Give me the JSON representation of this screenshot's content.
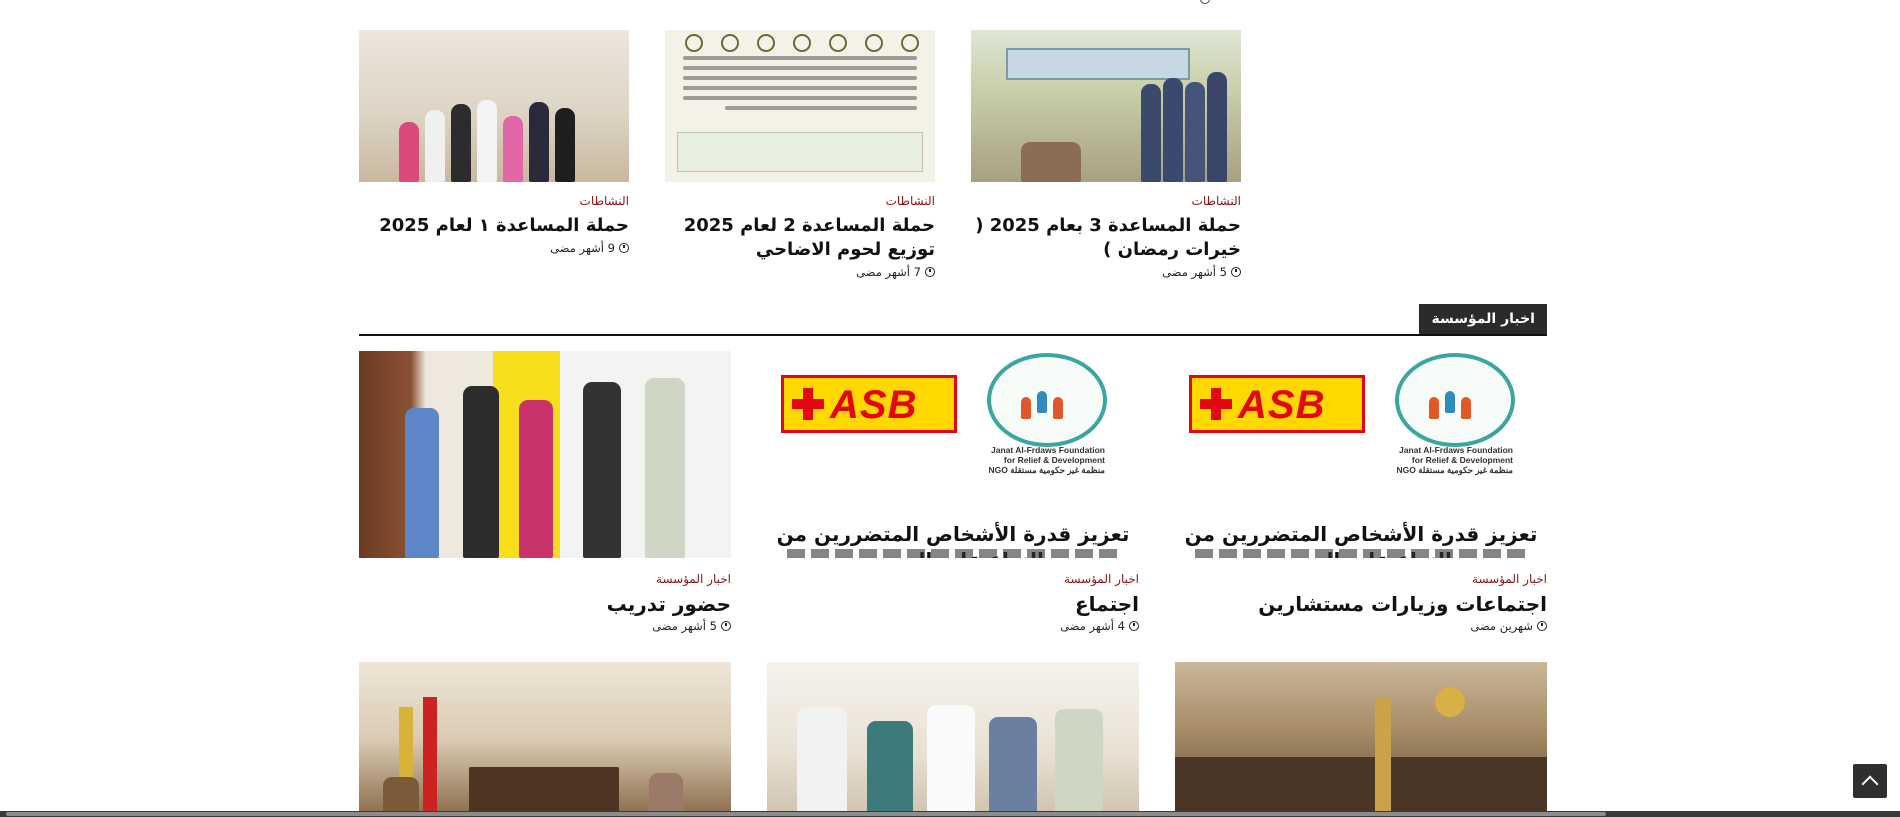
{
  "activities": [
    {
      "category": "النشاطات",
      "title": "حملة المساعدة ١ لعام 2025",
      "time": "9 أشهر مضى"
    },
    {
      "category": "النشاطات",
      "title": "حملة المساعدة 2 لعام 2025 توزيع لحوم الاضاحي",
      "time": "7 أشهر مضى"
    },
    {
      "category": "النشاطات",
      "title": "حملة المساعدة 3 بعام 2025 ( خيرات رمضان )",
      "time": "5 أشهر مضى"
    }
  ],
  "section": {
    "title": "اخبار المؤسسة"
  },
  "news": [
    {
      "category": "اخبار المؤسسة",
      "title": "حضور تدريب",
      "time": "5 أشهر مضى"
    },
    {
      "category": "اخبار المؤسسة",
      "title": "اجتماع",
      "time": "4 أشهر مضى"
    },
    {
      "category": "اخبار المؤسسة",
      "title": "اجتماعات وزيارات مستشارين",
      "time": "شهرين مضى"
    }
  ],
  "logo": {
    "asb_text": "ASB",
    "foundation_en_1": "Janat Al-Frdaws Foundation",
    "foundation_en_2": "for Relief & Development",
    "foundation_ar": "منظمة غير حكومية مستقلة NGO",
    "slogan": "تعزيز قدرة الأشخاص المتضررين من النزاع على الصمود"
  },
  "colors": {
    "category": "#8a1515",
    "section_bg": "#2b2b2b",
    "asb_yellow": "#ffd800",
    "asb_red": "#e30613"
  },
  "icons": {
    "time": "clock-icon",
    "back_to_top": "chevron-up-icon"
  }
}
